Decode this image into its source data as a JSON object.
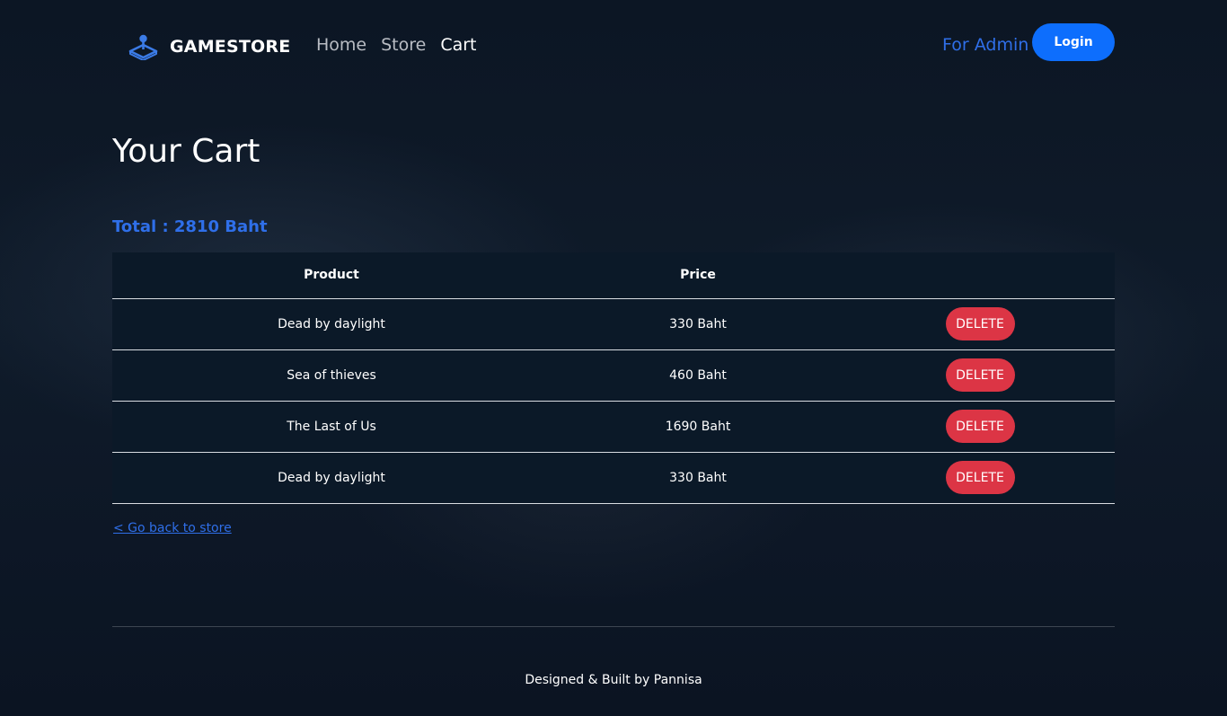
{
  "navbar": {
    "brand": "GAMESTORE",
    "brand_icon": "joystick-icon",
    "links": [
      {
        "label": "Home",
        "active": false
      },
      {
        "label": "Store",
        "active": false
      },
      {
        "label": "Cart",
        "active": true
      }
    ],
    "admin_link": "For Admin",
    "login_button": "Login"
  },
  "page": {
    "title": "Your Cart",
    "total": "Total : 2810 Baht"
  },
  "table": {
    "headers": [
      "Product",
      "Price",
      ""
    ],
    "rows": [
      {
        "product": "Dead by daylight",
        "price": "330 Baht",
        "action": "DELETE"
      },
      {
        "product": "Sea of thieves",
        "price": "460 Baht",
        "action": "DELETE"
      },
      {
        "product": "The Last of Us",
        "price": "1690 Baht",
        "action": "DELETE"
      },
      {
        "product": "Dead by daylight",
        "price": "330 Baht",
        "action": "DELETE"
      }
    ]
  },
  "back_link": "< Go back to store",
  "footer": {
    "text": "Designed & Built by Pannisa"
  },
  "colors": {
    "accent": "#0d6efd",
    "link": "#2f6fe9",
    "danger": "#dc3545",
    "background": "#0f1b2a"
  }
}
